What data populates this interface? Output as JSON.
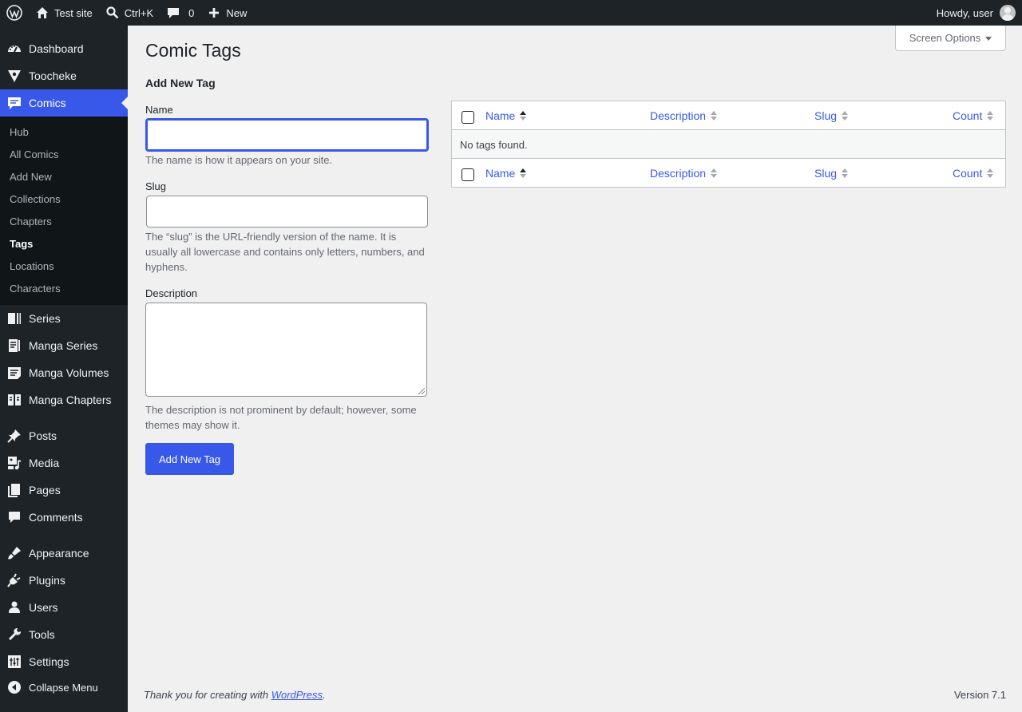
{
  "adminbar": {
    "site_name": "Test site",
    "search_shortcut": "Ctrl+K",
    "comments_count": "0",
    "new_label": "New",
    "howdy": "Howdy, user"
  },
  "sidebar": {
    "top_items": [
      {
        "label": "Dashboard",
        "icon": "dashboard-icon"
      },
      {
        "label": "Toocheke",
        "icon": "toocheke-icon"
      },
      {
        "label": "Comics",
        "icon": "comics-icon"
      }
    ],
    "submenu": [
      "Hub",
      "All Comics",
      "Add New",
      "Collections",
      "Chapters",
      "Tags",
      "Locations",
      "Characters"
    ],
    "group2": [
      {
        "label": "Series",
        "icon": "series-icon"
      },
      {
        "label": "Manga Series",
        "icon": "manga-series-icon"
      },
      {
        "label": "Manga Volumes",
        "icon": "manga-volumes-icon"
      },
      {
        "label": "Manga Chapters",
        "icon": "manga-chapters-icon"
      }
    ],
    "group3": [
      {
        "label": "Posts",
        "icon": "pin-icon"
      },
      {
        "label": "Media",
        "icon": "media-icon"
      },
      {
        "label": "Pages",
        "icon": "pages-icon"
      },
      {
        "label": "Comments",
        "icon": "comment-icon"
      }
    ],
    "group4": [
      {
        "label": "Appearance",
        "icon": "brush-icon"
      },
      {
        "label": "Plugins",
        "icon": "plug-icon"
      },
      {
        "label": "Users",
        "icon": "user-icon"
      },
      {
        "label": "Tools",
        "icon": "wrench-icon"
      },
      {
        "label": "Settings",
        "icon": "settings-icon"
      }
    ],
    "collapse_label": "Collapse Menu"
  },
  "screen_options": "Screen Options",
  "page_title": "Comic Tags",
  "form": {
    "title": "Add New Tag",
    "name_label": "Name",
    "name_value": "",
    "name_help": "The name is how it appears on your site.",
    "slug_label": "Slug",
    "slug_value": "",
    "slug_help": "The “slug” is the URL-friendly version of the name. It is usually all lowercase and contains only letters, numbers, and hyphens.",
    "description_label": "Description",
    "description_value": "",
    "description_help": "The description is not prominent by default; however, some themes may show it.",
    "submit_label": "Add New Tag"
  },
  "table": {
    "columns": [
      "Name",
      "Description",
      "Slug",
      "Count"
    ],
    "empty_message": "No tags found."
  },
  "footer": {
    "thanks_prefix": "Thank you for creating with ",
    "thanks_link": "WordPress",
    "thanks_suffix": ".",
    "version": "Version 7.1"
  },
  "colors": {
    "accent": "#3858e9",
    "sidebar_bg": "#1d2327",
    "submenu_bg": "#101517",
    "page_bg": "#f0f0f1"
  }
}
